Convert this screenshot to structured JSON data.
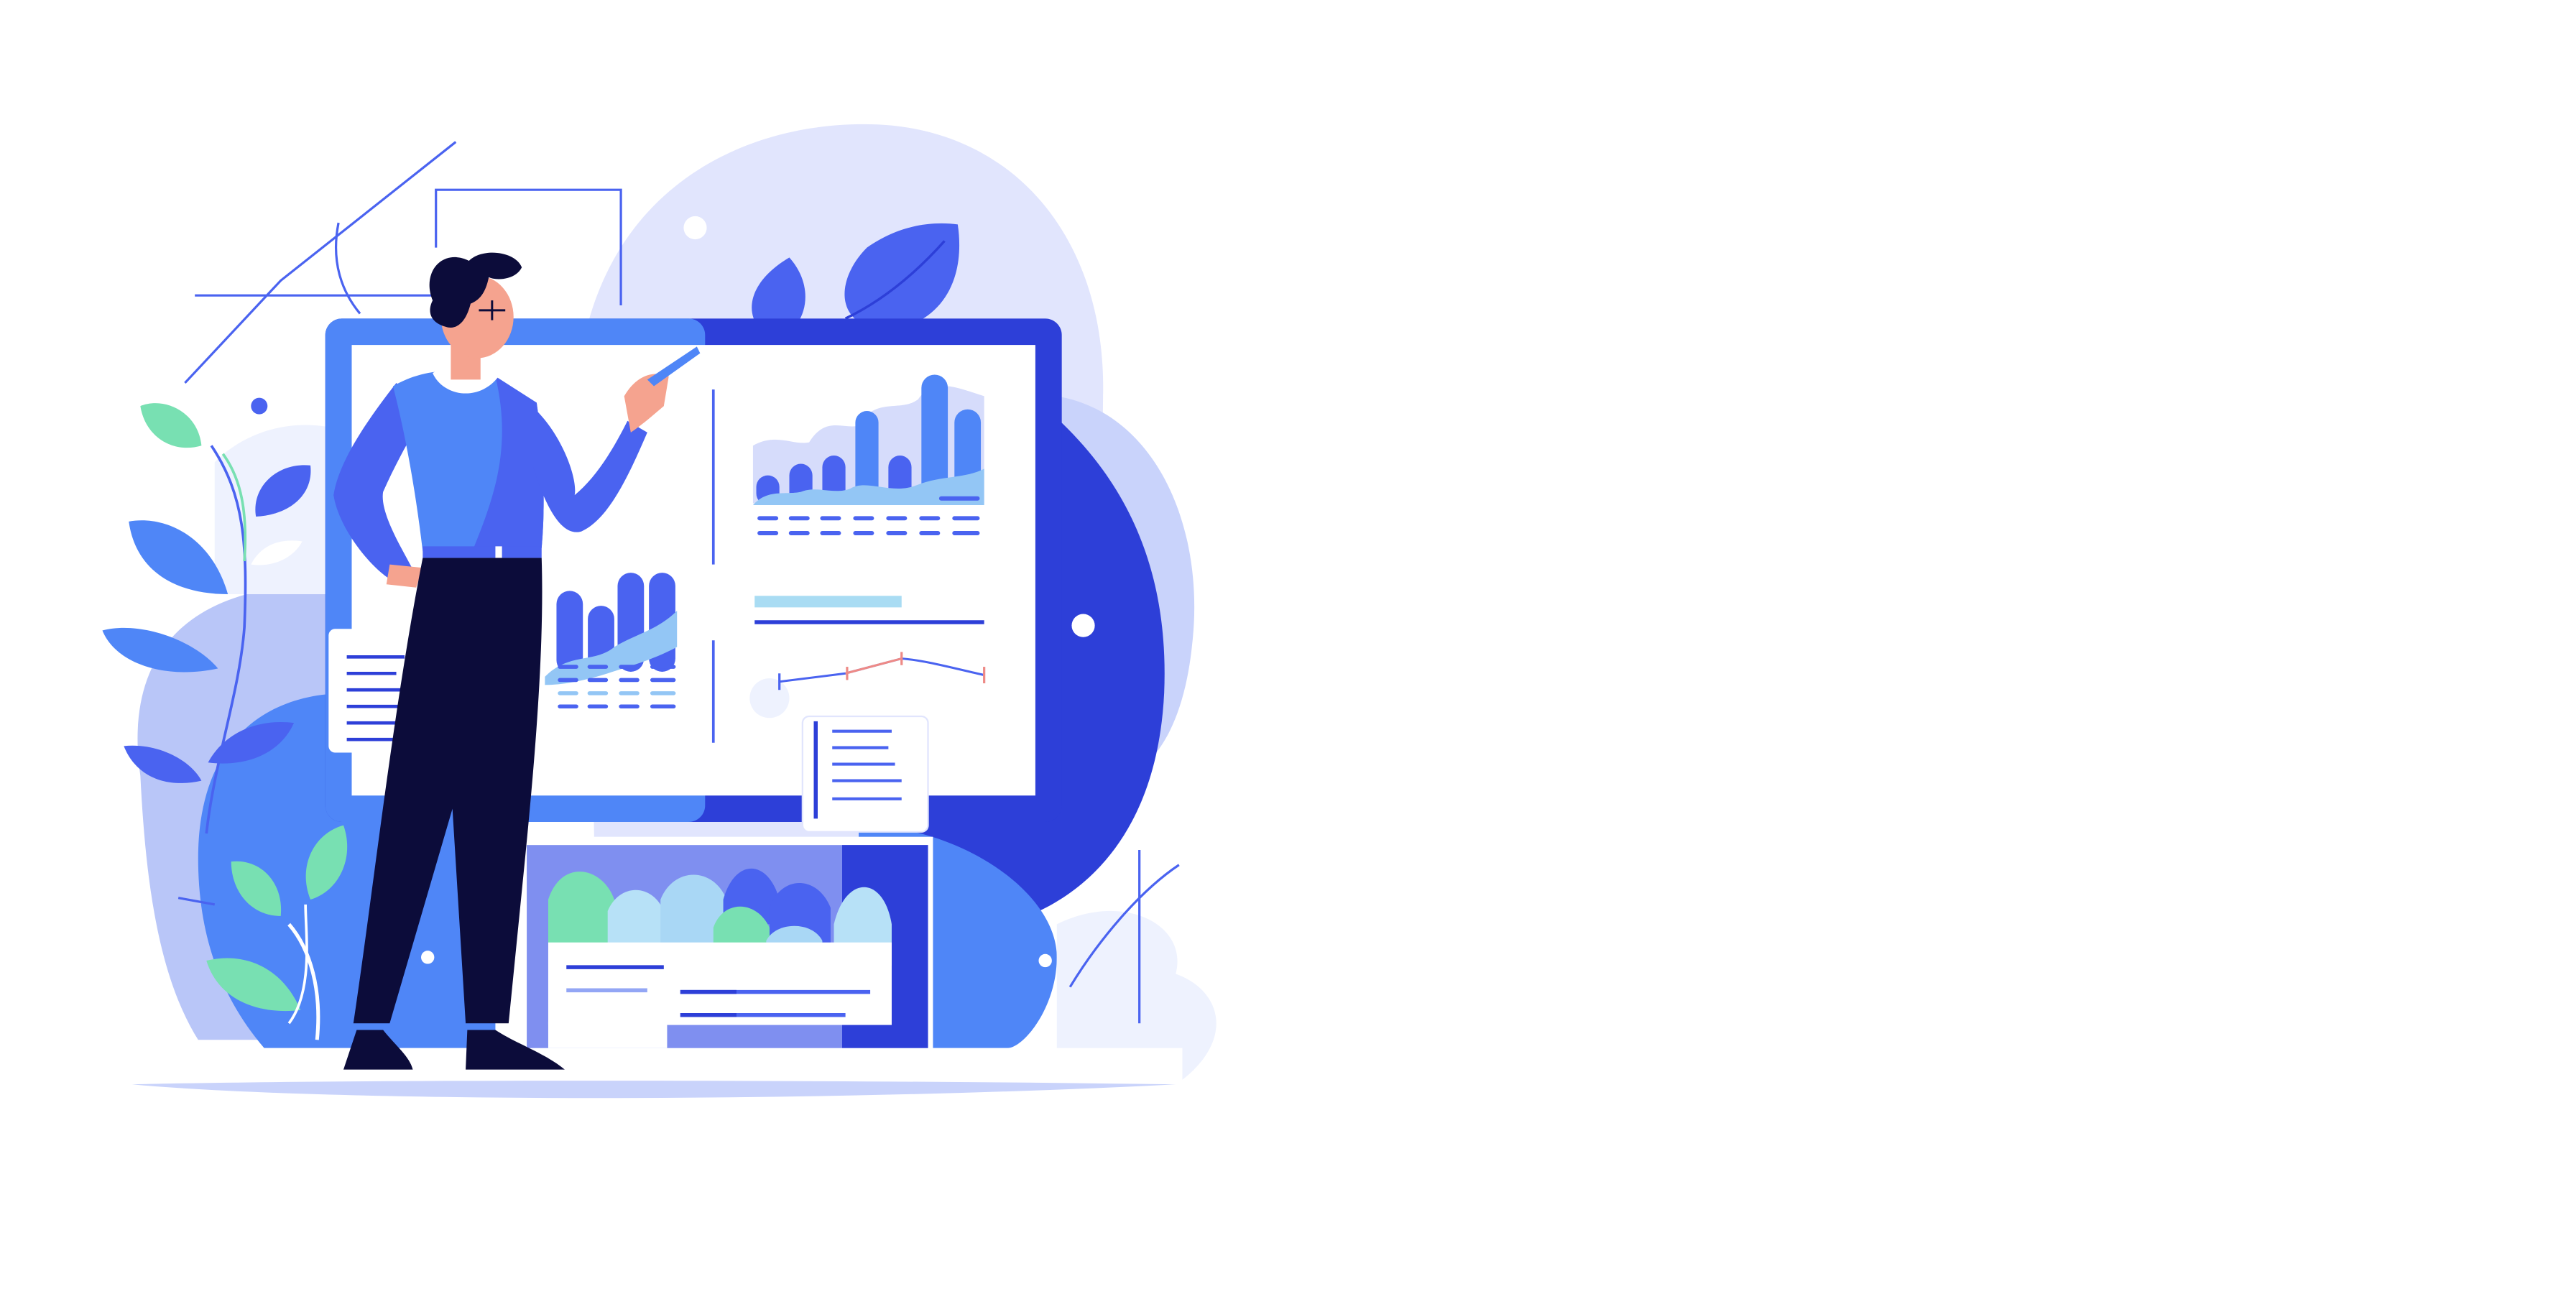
{
  "scene": {
    "subject": "analyst-presenting-dashboard",
    "background_color": "#ffffff",
    "palette": {
      "primary_blue": "#4a63f0",
      "deep_blue": "#2d3fd8",
      "mid_blue": "#4f86f7",
      "soft_blue": "#93a6f5",
      "pale_blue": "#c9d3fb",
      "lavender": "#e1e5fd",
      "ice_blue": "#eef2fe",
      "light_cyan": "#b7e1f7",
      "mint": "#78e0b2",
      "navy": "#0c0c3a",
      "skin": "#f5a38f",
      "coral_line": "#ee8a86",
      "white": "#ffffff"
    },
    "icons": [
      "monitor-icon",
      "bar-chart-icon",
      "line-chart-icon",
      "document-icon",
      "leaf-icon",
      "person-icon"
    ]
  }
}
